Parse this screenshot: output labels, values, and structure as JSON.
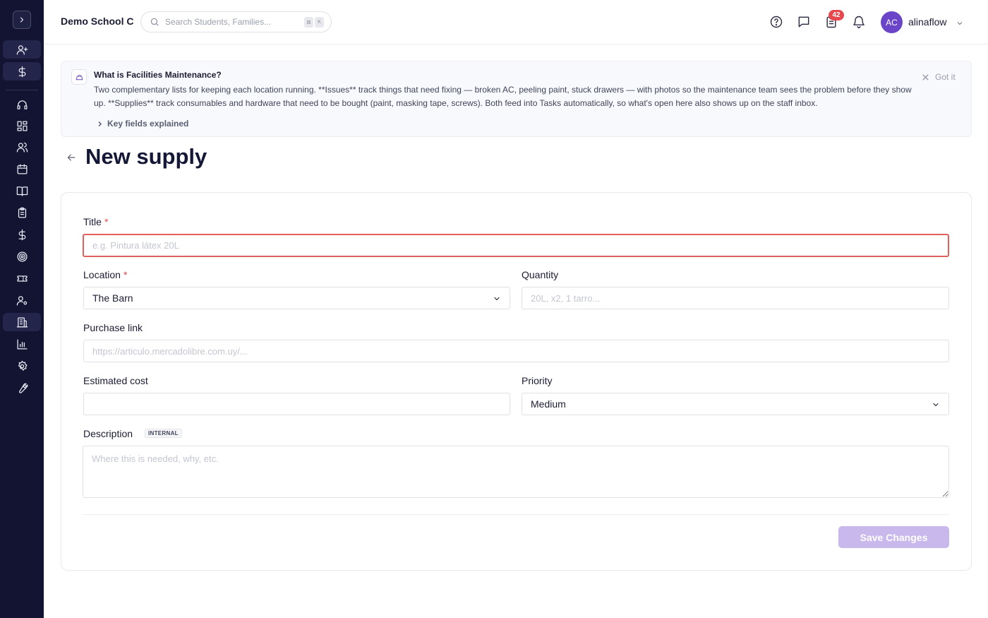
{
  "app": {
    "school_name": "Demo School C"
  },
  "search": {
    "placeholder": "Search Students, Families...",
    "shortcut_key1": "⌘",
    "shortcut_key2": "K"
  },
  "notifications": {
    "tasks_count": "42"
  },
  "user": {
    "initials": "AC",
    "name": "alinaflow"
  },
  "sidebar": {
    "items": [
      {
        "icon": "user-plus-icon"
      },
      {
        "icon": "dollar-icon"
      },
      {
        "icon": "headset-icon"
      },
      {
        "icon": "dashboard-icon"
      },
      {
        "icon": "users-icon"
      },
      {
        "icon": "calendar-icon"
      },
      {
        "icon": "book-icon"
      },
      {
        "icon": "clipboard-icon"
      },
      {
        "icon": "dollar-icon"
      },
      {
        "icon": "target-icon"
      },
      {
        "icon": "ticket-icon"
      },
      {
        "icon": "user-gear-icon"
      },
      {
        "icon": "building-icon",
        "active": true
      },
      {
        "icon": "bar-chart-icon"
      },
      {
        "icon": "settings-icon"
      },
      {
        "icon": "wrench-icon"
      }
    ]
  },
  "banner": {
    "title": "What is Facilities Maintenance?",
    "text": "Two complementary lists for keeping each location running. **Issues** track things that need fixing — broken AC, peeling paint, stuck drawers — with photos so the maintenance team sees the problem before they show up. **Supplies** track consumables and hardware that need to be bought (paint, masking tape, screws). Both feed into Tasks automatically, so what's open here also shows up on the staff inbox.",
    "dismiss_label": "Got it",
    "key_fields_label": "Key fields explained"
  },
  "page": {
    "title": "New supply"
  },
  "form": {
    "title_label": "Title",
    "required_mark": "*",
    "title_placeholder": "e.g. Pintura látex 20L",
    "location_label": "Location",
    "location_value": "The Barn",
    "quantity_label": "Quantity",
    "quantity_placeholder": "20L, x2, 1 tarro...",
    "purchase_link_label": "Purchase link",
    "purchase_link_placeholder": "https://articulo.mercadolibre.com.uy/...",
    "estimated_cost_label": "Estimated cost",
    "priority_label": "Priority",
    "priority_value": "Medium",
    "description_label": "Description",
    "description_tag": "INTERNAL",
    "description_placeholder": "Where this is needed, why, etc.",
    "save_label": "Save Changes"
  },
  "colors": {
    "sidebar_bg": "#121432",
    "accent": "#6b45c7",
    "save_disabled": "#c9b8ec",
    "error": "#e5484d"
  }
}
